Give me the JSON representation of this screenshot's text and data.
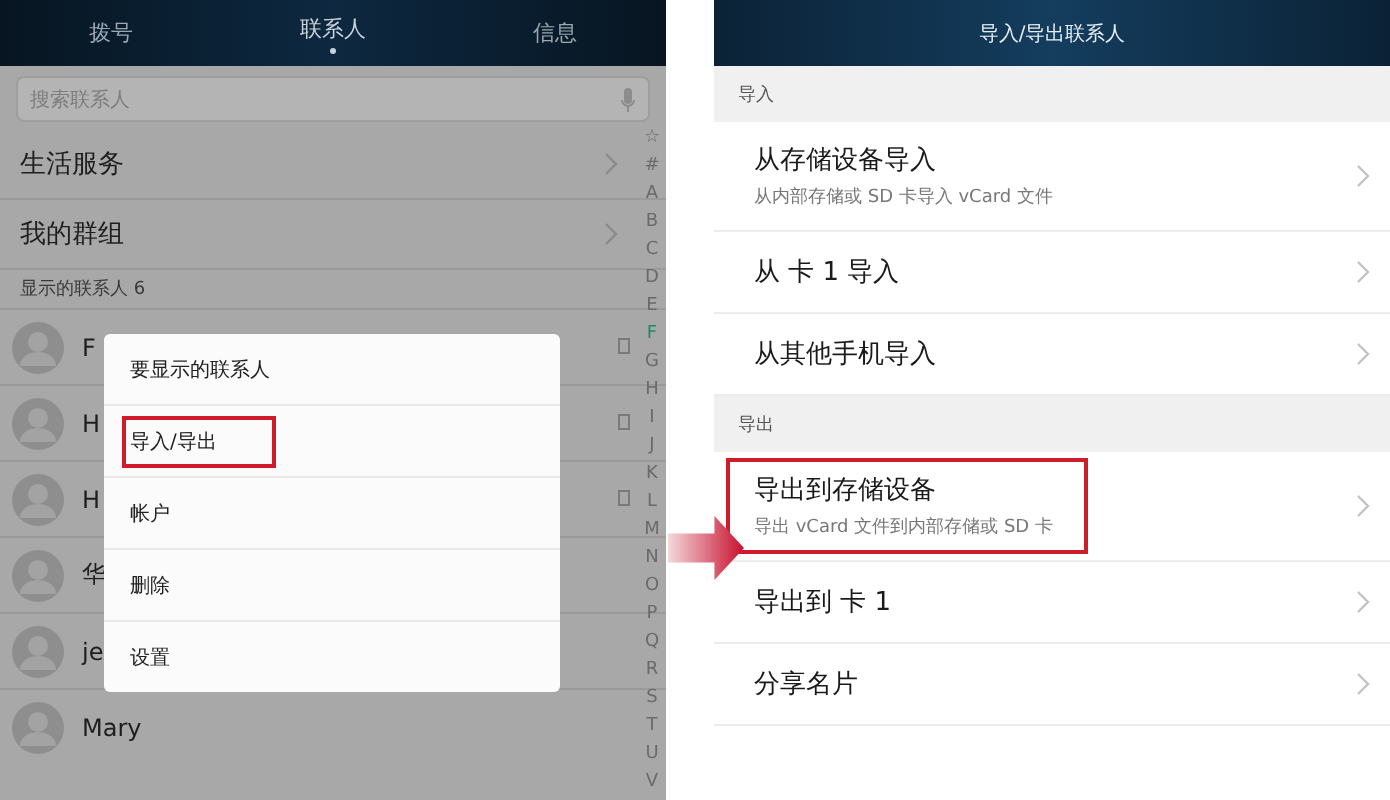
{
  "left": {
    "tabs": [
      {
        "label": "拨号",
        "selected": false
      },
      {
        "label": "联系人",
        "selected": true
      },
      {
        "label": "信息",
        "selected": false
      }
    ],
    "search": {
      "placeholder": "搜索联系人"
    },
    "groups": [
      "生活服务",
      "我的群组"
    ],
    "section": "显示的联系人 6",
    "contacts": [
      {
        "name": "F",
        "sim": true
      },
      {
        "name": "H",
        "sim": true
      },
      {
        "name": "H",
        "sim": true
      },
      {
        "name": "华",
        "sim": false
      },
      {
        "name": "je",
        "sim": false
      },
      {
        "name": "Mary",
        "sim": false
      }
    ],
    "index": [
      {
        "label": "☆",
        "selected": false
      },
      {
        "label": "#",
        "selected": false
      },
      {
        "label": "A",
        "selected": false
      },
      {
        "label": "B",
        "selected": false
      },
      {
        "label": "C",
        "selected": false
      },
      {
        "label": "D",
        "selected": false
      },
      {
        "label": "E",
        "selected": false
      },
      {
        "label": "F",
        "selected": true
      },
      {
        "label": "G",
        "selected": false
      },
      {
        "label": "H",
        "selected": false
      },
      {
        "label": "I",
        "selected": false
      },
      {
        "label": "J",
        "selected": false
      },
      {
        "label": "K",
        "selected": false
      },
      {
        "label": "L",
        "selected": false
      },
      {
        "label": "M",
        "selected": false
      },
      {
        "label": "N",
        "selected": false
      },
      {
        "label": "O",
        "selected": false
      },
      {
        "label": "P",
        "selected": false
      },
      {
        "label": "Q",
        "selected": false
      },
      {
        "label": "R",
        "selected": false
      },
      {
        "label": "S",
        "selected": false
      },
      {
        "label": "T",
        "selected": false
      },
      {
        "label": "U",
        "selected": false
      },
      {
        "label": "V",
        "selected": false
      }
    ],
    "menu": [
      {
        "label": "要显示的联系人",
        "highlighted": false
      },
      {
        "label": "导入/导出",
        "highlighted": true
      },
      {
        "label": "帐户",
        "highlighted": false
      },
      {
        "label": "删除",
        "highlighted": false
      },
      {
        "label": "设置",
        "highlighted": false
      }
    ]
  },
  "right": {
    "title": "导入/导出联系人",
    "sections": [
      {
        "heading": "导入",
        "items": [
          {
            "title": "从存储设备导入",
            "subtitle": "从内部存储或 SD 卡导入 vCard 文件",
            "highlighted": false
          },
          {
            "title": "从 卡 1 导入",
            "highlighted": false
          },
          {
            "title": "从其他手机导入",
            "highlighted": false
          }
        ]
      },
      {
        "heading": "导出",
        "items": [
          {
            "title": "导出到存储设备",
            "subtitle": "导出 vCard 文件到内部存储或 SD 卡",
            "highlighted": true
          },
          {
            "title": "导出到 卡 1",
            "highlighted": false
          },
          {
            "title": "分享名片",
            "highlighted": false
          }
        ]
      }
    ]
  }
}
